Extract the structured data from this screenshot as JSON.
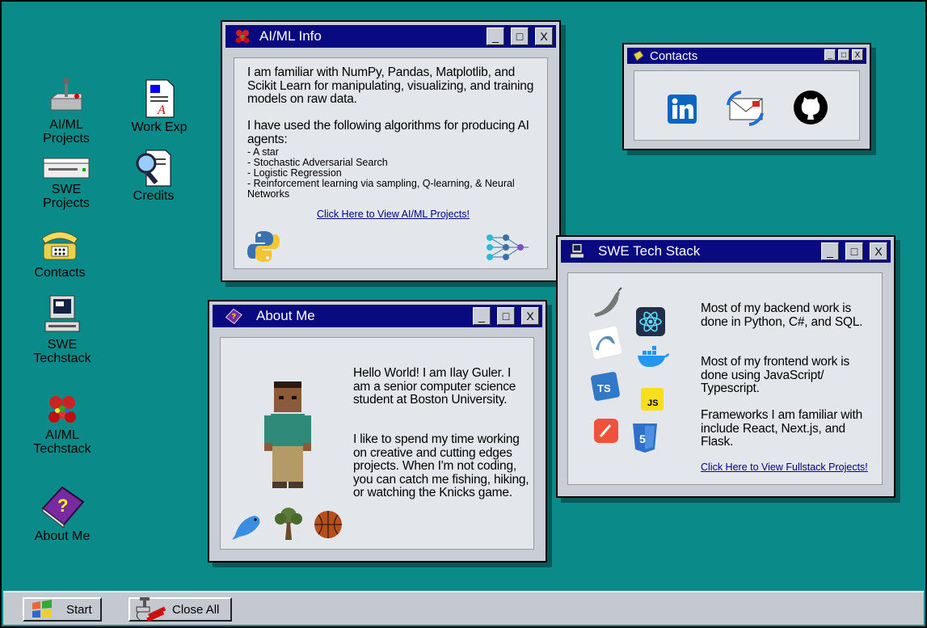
{
  "desktop_icons": [
    {
      "label": "AI/ML\nProjects",
      "icon": "joystick-icon"
    },
    {
      "label": "Work Exp",
      "icon": "document-icon"
    },
    {
      "label": "SWE\nProjects",
      "icon": "drive-icon"
    },
    {
      "label": "Credits",
      "icon": "magnifier-document-icon"
    },
    {
      "label": "Contacts",
      "icon": "telephone-icon"
    },
    {
      "label": "SWE\nTechstack",
      "icon": "computer-icon"
    },
    {
      "label": "AI/ML\nTechstack",
      "icon": "molecule-icon"
    },
    {
      "label": "About Me",
      "icon": "help-book-icon"
    }
  ],
  "aiml_window": {
    "title": "AI/ML Info",
    "para1": "I am familiar with NumPy, Pandas, Matplotlib, and Scikit Learn for manipulating, visualizing, and training models on raw data.",
    "para2": "I have used the following algorithms for producing AI agents:",
    "algorithms": [
      "- A star",
      "- Stochastic Adversarial Search",
      "- Logistic Regression",
      "- Reinforcement learning via sampling, Q-learning, & Neural Networks"
    ],
    "link": "Click Here to View AI/ML Projects!"
  },
  "contacts_window": {
    "title": "Contacts",
    "icons": [
      "linkedin-icon",
      "email-icon",
      "github-icon"
    ]
  },
  "swe_window": {
    "title": "SWE Tech Stack",
    "para1": "Most of my backend work is done in Python, C#, and SQL.",
    "para2": "Most of my frontend work is done using JavaScript/ Typescript.",
    "para3": "Frameworks I am familiar with include React, Next.js, and Flask.",
    "link": "Click Here to View Fullstack Projects!"
  },
  "about_window": {
    "title": "About Me",
    "para1": "Hello World! I am Ilay Guler. I am a senior computer science student at Boston University.",
    "para2": "I like to spend my time working on creative and cutting edges projects. When I'm not coding, you can catch me fishing, hiking, or watching the Knicks game."
  },
  "title_buttons": {
    "minimize": "_",
    "maximize": "□",
    "close": "X"
  },
  "taskbar": {
    "start": "Start",
    "close_all": "Close All"
  },
  "colors": {
    "desktop": "#0b8a8a",
    "titlebar": "#0a0a80",
    "window": "#c9ced6"
  }
}
